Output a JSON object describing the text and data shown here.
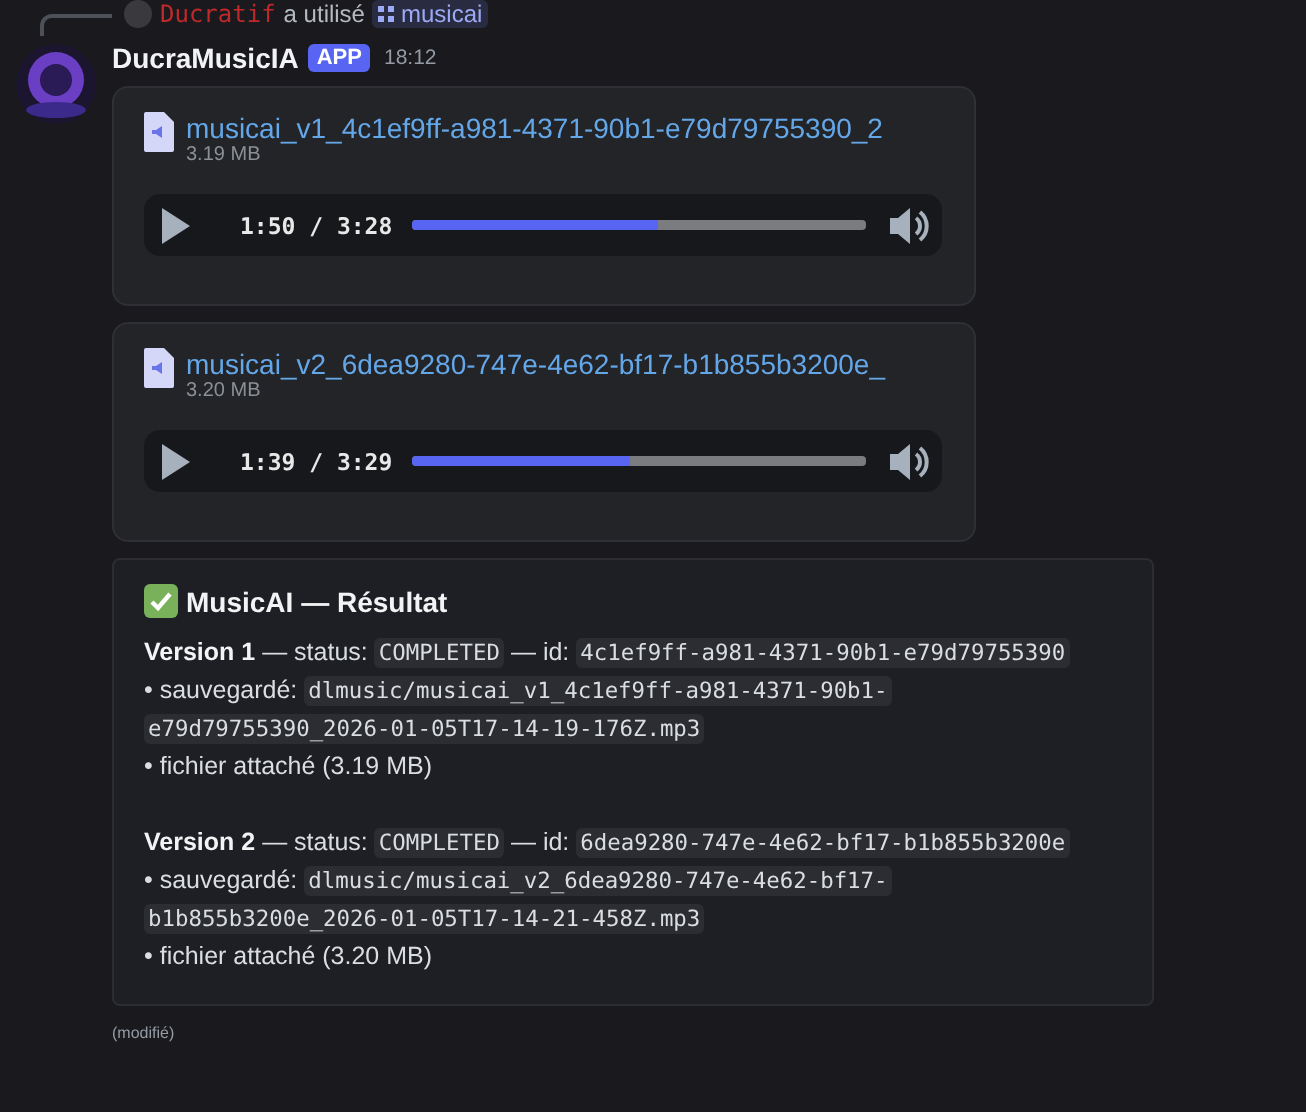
{
  "reply": {
    "user": "Ducratif",
    "action": "a utilisé",
    "command": "musicai"
  },
  "message": {
    "author": "DucraMusicIA",
    "badge": "APP",
    "time": "18:12",
    "edited": "(modifié)"
  },
  "attachments": [
    {
      "filename": "musicai_v1_4c1ef9ff-a981-4371-90b1-e79d79755390_2",
      "size": "3.19 MB",
      "time": "1:50 / 3:28",
      "level": 0.54
    },
    {
      "filename": "musicai_v2_6dea9280-747e-4e62-bf17-b1b855b3200e_",
      "size": "3.20 MB",
      "time": "1:39 / 3:29",
      "level": 0.48
    }
  ],
  "embed": {
    "title": "MusicAI — Résultat",
    "versions": [
      {
        "label": "Version 1",
        "status_label": "— status:",
        "status": "COMPLETED",
        "id_label": "— id:",
        "id": "4c1ef9ff-a981-4371-90b1-e79d79755390",
        "saved_label": "• sauvegardé:",
        "saved_path": [
          "dlmusic/musicai_v1_4c1ef9ff-a981-4371-90b1-",
          "e79d79755390_2026-01-05T17-14-19-176Z.mp3"
        ],
        "attached": "• fichier attaché (3.19 MB)"
      },
      {
        "label": "Version 2",
        "status_label": "— status:",
        "status": "COMPLETED",
        "id_label": "— id:",
        "id": "6dea9280-747e-4e62-bf17-b1b855b3200e",
        "saved_label": "• sauvegardé:",
        "saved_path": [
          "dlmusic/musicai_v2_6dea9280-747e-4e62-bf17-",
          "b1b855b3200e_2026-01-05T17-14-21-458Z.mp3"
        ],
        "attached": "• fichier attaché (3.20 MB)"
      }
    ]
  }
}
